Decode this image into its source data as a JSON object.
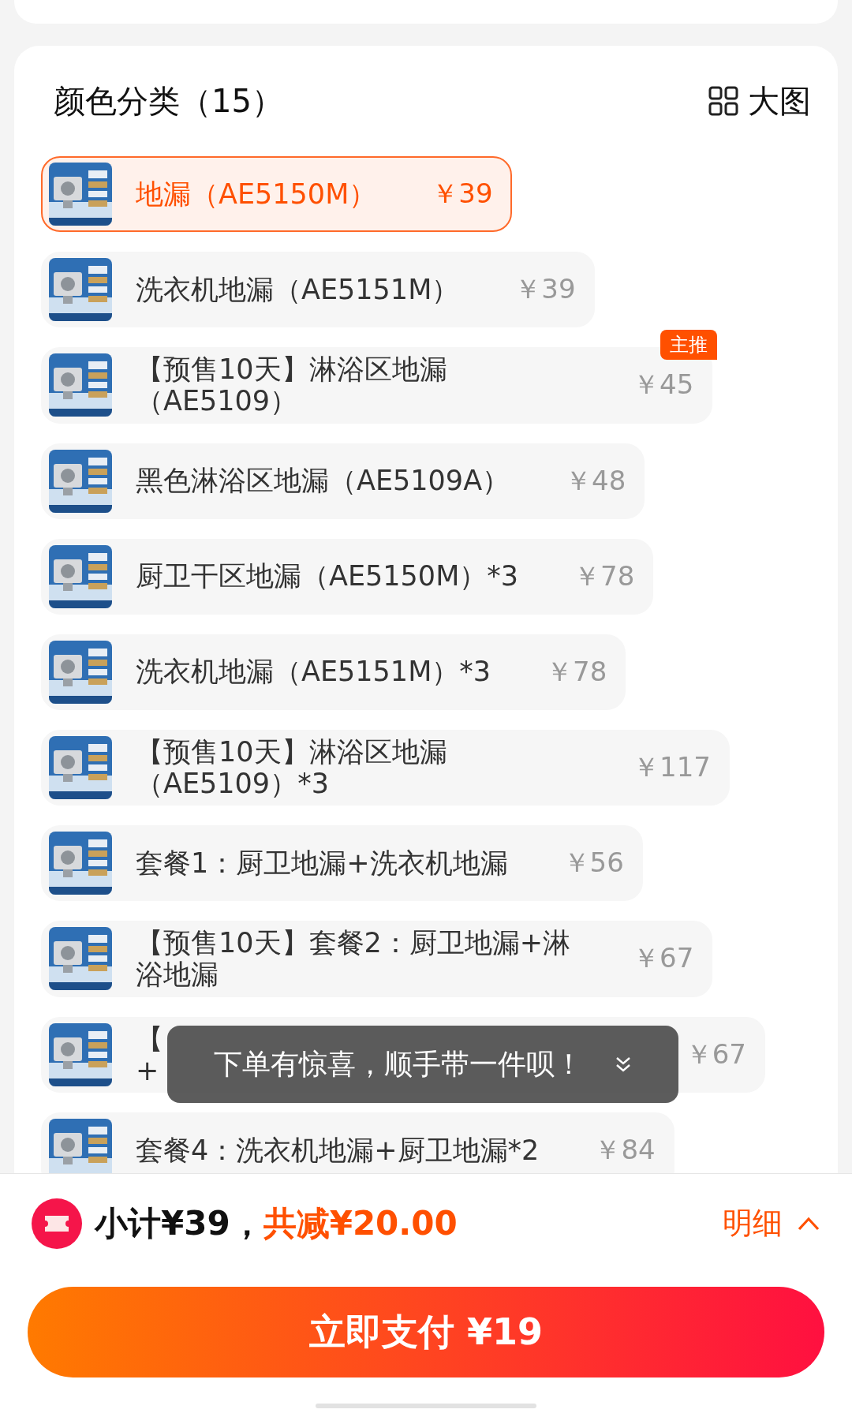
{
  "header": {
    "title": "颜色分类（15）",
    "view_toggle": "大图"
  },
  "options": [
    {
      "name": "地漏（AE5150M）",
      "price": "￥39",
      "selected": true
    },
    {
      "name": "洗衣机地漏（AE5151M）",
      "price": "￥39",
      "selected": false
    },
    {
      "name": "【预售10天】淋浴区地漏（AE5109）",
      "price": "￥45",
      "selected": false,
      "tag": "主推"
    },
    {
      "name": "黑色淋浴区地漏（AE5109A）",
      "price": "￥48",
      "selected": false
    },
    {
      "name": "厨卫干区地漏（AE5150M）*3",
      "price": "￥78",
      "selected": false
    },
    {
      "name": "洗衣机地漏（AE5151M）*3",
      "price": "￥78",
      "selected": false
    },
    {
      "name": "【预售10天】淋浴区地漏（AE5109）*3",
      "price": "￥117",
      "selected": false
    },
    {
      "name": "套餐1：厨卫地漏+洗衣机地漏",
      "price": "￥56",
      "selected": false
    },
    {
      "name": "【预售10天】套餐2：厨卫地漏+淋浴地漏",
      "price": "￥67",
      "selected": false
    },
    {
      "name": "【\n+",
      "price": "￥67",
      "selected": false
    },
    {
      "name": "套餐4：洗衣机地漏+厨卫地漏*2",
      "price": "￥84",
      "selected": false
    }
  ],
  "toast": {
    "text": "下单有惊喜，顺手带一件呗！"
  },
  "footer": {
    "subtotal": "小计¥39，",
    "discount": "共减¥20.00",
    "detail": "明细",
    "pay_button": "立即支付 ¥19"
  }
}
